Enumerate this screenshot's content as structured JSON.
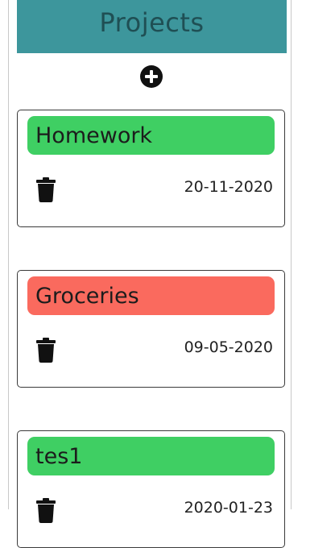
{
  "header": {
    "title": "Projects"
  },
  "add_button": {
    "icon": "plus-circle-icon"
  },
  "projects": [
    {
      "title": "Homework",
      "date": "20-11-2020",
      "color": "#3fcf63"
    },
    {
      "title": "Groceries",
      "date": "09-05-2020",
      "color": "#fa6a5e"
    },
    {
      "title": "tes1",
      "date": "2020-01-23",
      "color": "#3fcf63"
    }
  ],
  "colors": {
    "header_bg": "#3d969c",
    "header_text": "#1f4f54",
    "green": "#3fcf63",
    "red": "#fa6a5e"
  }
}
